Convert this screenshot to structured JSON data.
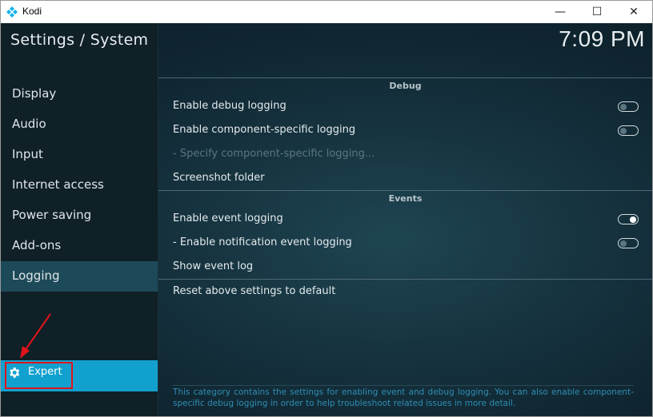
{
  "window": {
    "title": "Kodi",
    "controls": {
      "minimize": "—",
      "maximize": "☐",
      "close": "✕"
    }
  },
  "header": {
    "page_title": "Settings / System",
    "clock": "7:09 PM"
  },
  "sidebar": {
    "items": [
      {
        "label": "Display"
      },
      {
        "label": "Audio"
      },
      {
        "label": "Input"
      },
      {
        "label": "Internet access"
      },
      {
        "label": "Power saving"
      },
      {
        "label": "Add-ons"
      },
      {
        "label": "Logging"
      }
    ],
    "expert_label": "Expert"
  },
  "settings": {
    "debug_header": "Debug",
    "enable_debug_logging": "Enable debug logging",
    "enable_component_logging": "Enable component-specific logging",
    "specify_component_logging": "- Specify component-specific logging...",
    "screenshot_folder": "Screenshot folder",
    "events_header": "Events",
    "enable_event_logging": "Enable event logging",
    "enable_notification_logging": "- Enable notification event logging",
    "show_event_log": "Show event log",
    "reset_defaults": "Reset above settings to default",
    "toggles": {
      "enable_debug_logging": false,
      "enable_component_logging": false,
      "enable_event_logging": true,
      "enable_notification_logging": false
    }
  },
  "description": "This category contains the settings for enabling event and debug logging. You can also enable component-specific debug logging in order to help troubleshoot related issues in more detail.",
  "colors": {
    "accent": "#12a1cf",
    "highlight_box": "#e0141a",
    "active_item": "#1d4a59"
  }
}
